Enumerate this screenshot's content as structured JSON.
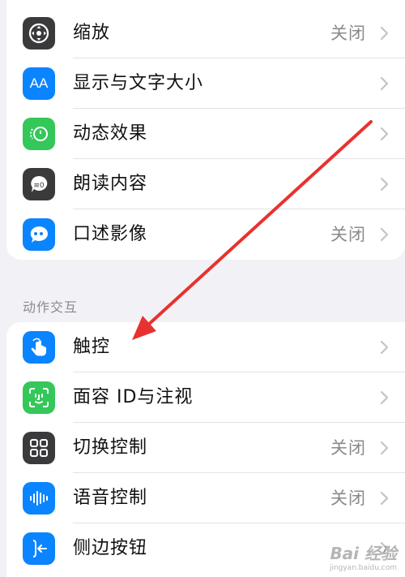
{
  "group1": {
    "items": [
      {
        "label": "缩放",
        "value": "关闭",
        "icon": "zoom-icon",
        "color": "#3a3a3c"
      },
      {
        "label": "显示与文字大小",
        "value": "",
        "icon": "text-size-icon",
        "color": "#0a84ff"
      },
      {
        "label": "动态效果",
        "value": "",
        "icon": "motion-icon",
        "color": "#34c759"
      },
      {
        "label": "朗读内容",
        "value": "",
        "icon": "spoken-content-icon",
        "color": "#3a3a3c"
      },
      {
        "label": "口述影像",
        "value": "关闭",
        "icon": "audio-descriptions-icon",
        "color": "#0a84ff"
      }
    ],
    "text_size_glyph": "AA"
  },
  "section2": {
    "header": "动作交互",
    "items": [
      {
        "label": "触控",
        "value": "",
        "icon": "touch-hand-icon",
        "color": "#0a84ff"
      },
      {
        "label": "面容 ID与注视",
        "value": "",
        "icon": "face-id-icon",
        "color": "#34c759"
      },
      {
        "label": "切换控制",
        "value": "关闭",
        "icon": "switch-control-icon",
        "color": "#3a3a3c"
      },
      {
        "label": "语音控制",
        "value": "关闭",
        "icon": "voice-control-icon",
        "color": "#0a84ff"
      },
      {
        "label": "侧边按钮",
        "value": "",
        "icon": "side-button-icon",
        "color": "#0a84ff"
      }
    ]
  },
  "annotation": {
    "arrow_color": "#e8322f"
  },
  "watermark": {
    "brand": "Bai 经验",
    "url": "jingyan.baidu.com"
  }
}
